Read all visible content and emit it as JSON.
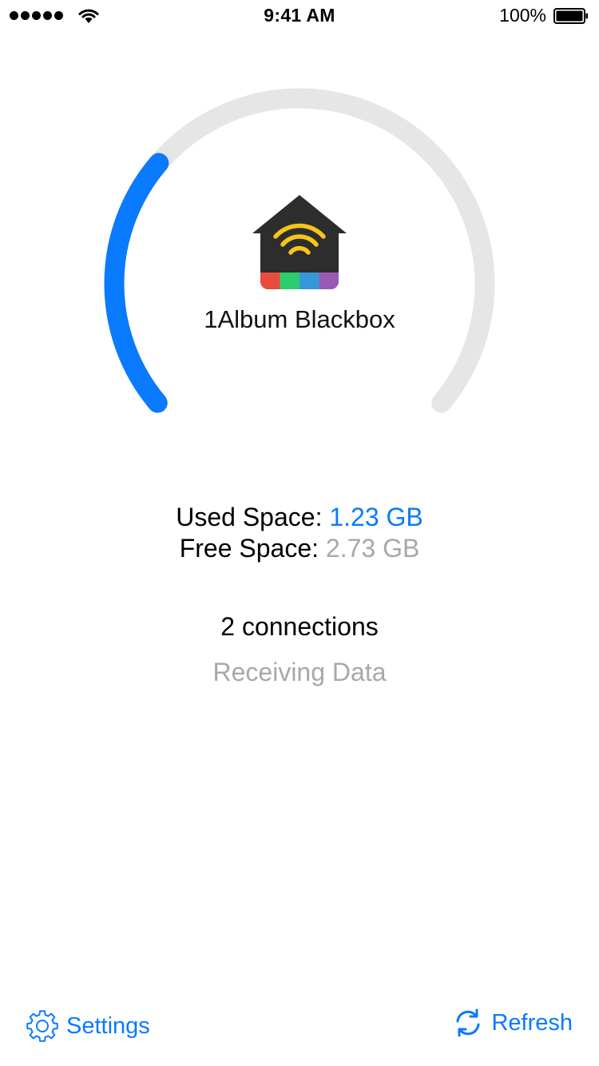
{
  "status_bar": {
    "time": "9:41 AM",
    "battery_percent": "100%",
    "signal_icon": "signal-dots-icon",
    "wifi_icon": "wifi-icon",
    "battery_icon": "battery-icon"
  },
  "gauge": {
    "used_fraction": 0.31,
    "used_color": "#0a7aff",
    "track_color": "#e6e6e6"
  },
  "device": {
    "icon": "wifi-house-icon",
    "name": "1Album Blackbox"
  },
  "storage": {
    "used_label": "Used Space:",
    "used_value": "1.23 GB",
    "free_label": "Free Space:",
    "free_value": "2.73 GB"
  },
  "connections": {
    "count_text": "2 connections",
    "status_text": "Receiving Data"
  },
  "toolbar": {
    "settings_label": "Settings",
    "settings_icon": "gear-icon",
    "refresh_label": "Refresh",
    "refresh_icon": "refresh-icon"
  },
  "colors": {
    "accent": "#0a7aff",
    "muted": "#a8a8a8"
  }
}
